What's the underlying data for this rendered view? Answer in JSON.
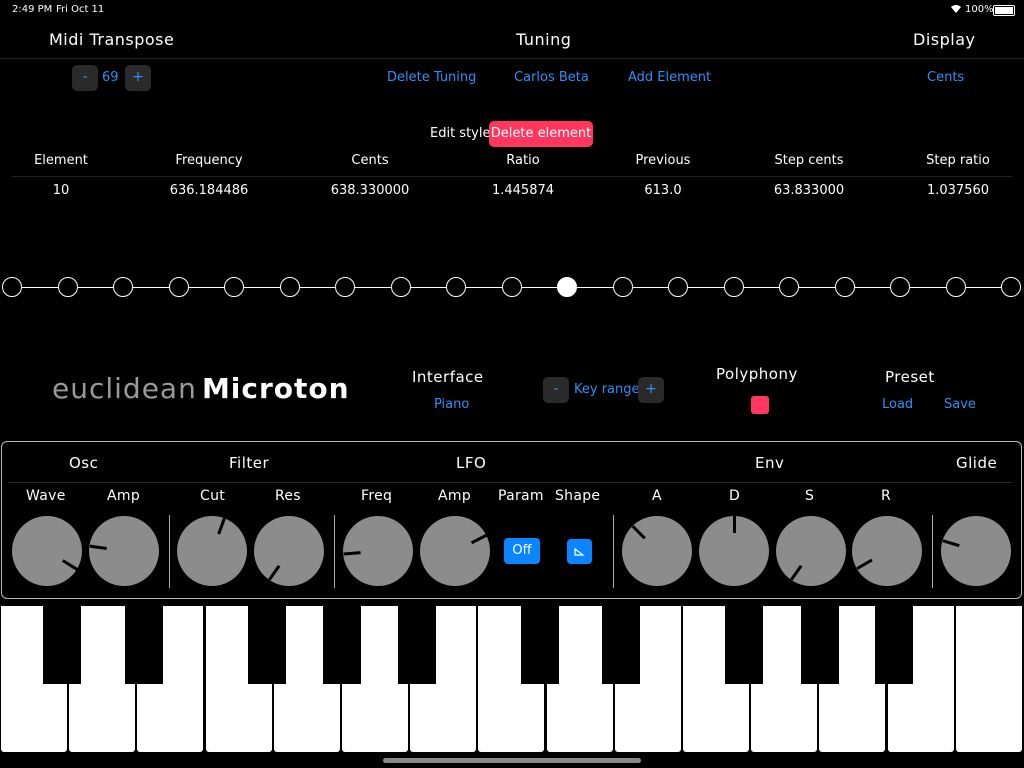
{
  "status_bar": {
    "time": "2:49 PM",
    "date": "Fri Oct 11",
    "battery": "100%"
  },
  "header": {
    "midi_transpose": "Midi Transpose",
    "tuning": "Tuning",
    "display": "Display"
  },
  "transpose": {
    "minus": "-",
    "value": "69",
    "plus": "+"
  },
  "tuning_actions": {
    "delete_tuning": "Delete Tuning",
    "tuning_name": "Carlos Beta",
    "add_element": "Add Element"
  },
  "display_mode": "Cents",
  "edit": {
    "edit_style": "Edit style",
    "delete_element": "Delete element"
  },
  "table": {
    "headers": [
      "Element",
      "Frequency",
      "Cents",
      "Ratio",
      "Previous",
      "Step cents",
      "Step ratio"
    ],
    "row": [
      "10",
      "636.184486",
      "638.330000",
      "1.445874",
      "613.0",
      "63.833000",
      "1.037560"
    ]
  },
  "scale_dots": {
    "count": 19,
    "selected_index": 10
  },
  "brand": {
    "part1": "euclidean",
    "part2": "Microton"
  },
  "interface": {
    "label": "Interface",
    "value": "Piano"
  },
  "key_range": {
    "minus": "-",
    "label": "Key range",
    "plus": "+"
  },
  "polyphony": {
    "label": "Polyphony",
    "enabled": true
  },
  "preset": {
    "label": "Preset",
    "load": "Load",
    "save": "Save"
  },
  "synth": {
    "sections": {
      "osc": "Osc",
      "filter": "Filter",
      "lfo": "LFO",
      "env": "Env",
      "glide": "Glide"
    },
    "knobs": {
      "wave": {
        "label": "Wave",
        "angle_deg": -58
      },
      "osc_amp": {
        "label": "Amp",
        "angle_deg": 98
      },
      "cut": {
        "label": "Cut",
        "angle_deg": 200
      },
      "res": {
        "label": "Res",
        "angle_deg": 35
      },
      "freq": {
        "label": "Freq",
        "angle_deg": 85
      },
      "lfo_amp": {
        "label": "Amp",
        "angle_deg": -117
      },
      "a": {
        "label": "A",
        "angle_deg": 135
      },
      "d": {
        "label": "D",
        "angle_deg": 180
      },
      "s": {
        "label": "S",
        "angle_deg": 35
      },
      "r": {
        "label": "R",
        "angle_deg": 60
      },
      "glide": {
        "label": "",
        "angle_deg": 107
      }
    },
    "param": {
      "label": "Param",
      "value": "Off"
    },
    "shape": {
      "label": "Shape",
      "icon": "ramp-icon"
    }
  },
  "colors": {
    "accent": "#0a84ff",
    "danger": "#ff375f"
  }
}
